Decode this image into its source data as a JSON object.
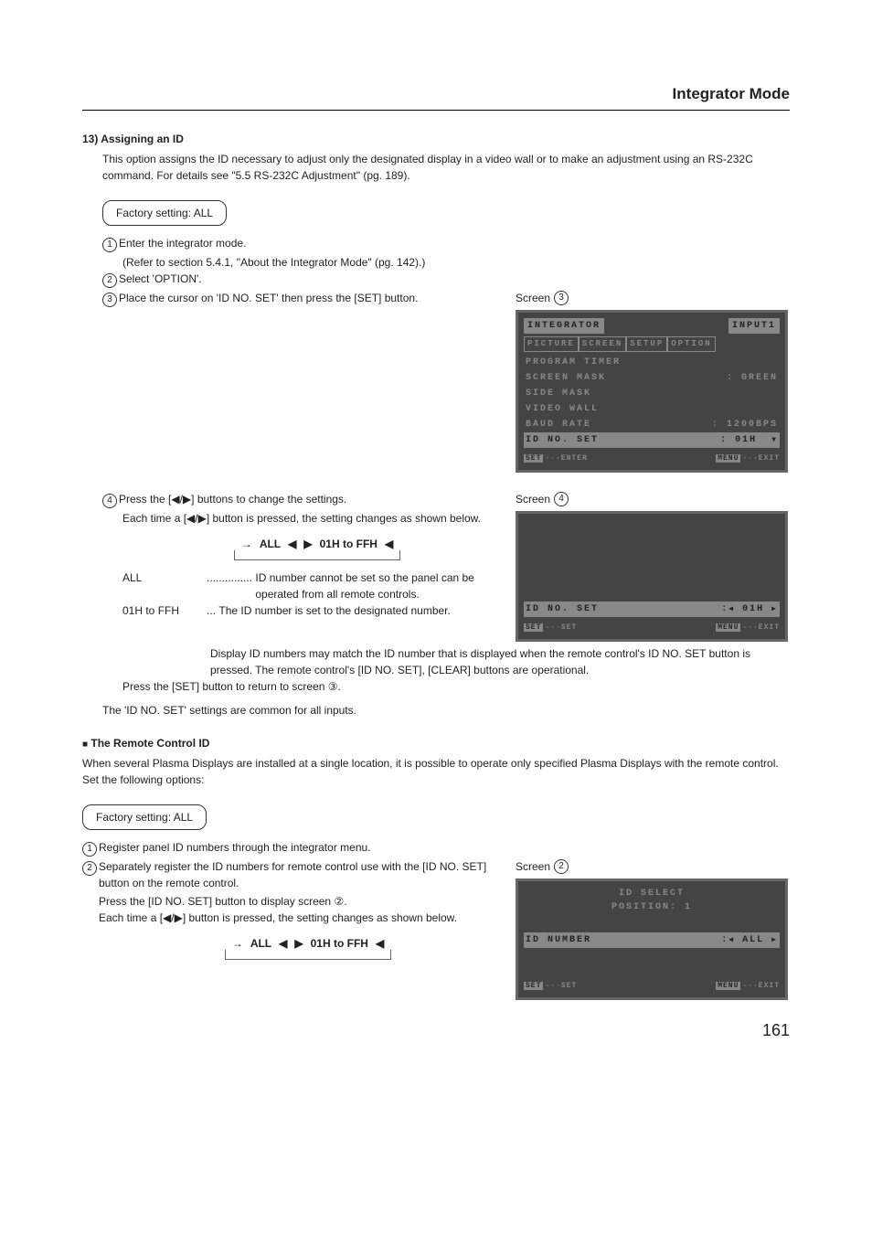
{
  "page_title": "Integrator Mode",
  "h13": "13) Assigning an ID",
  "intro": "This option assigns the ID necessary to adjust only the designated display in a video wall or to make an adjustment using an RS-232C command. For details see \"5.5 RS-232C Adjustment\" (pg. 189).",
  "factory_a": "Factory setting: ALL",
  "step1": "Enter the integrator mode.",
  "step1_sub": "(Refer to section 5.4.1, \"About the Integrator Mode\" (pg. 142).)",
  "step2": "Select 'OPTION'.",
  "step3": "Place the cursor on 'ID NO. SET' then press the [SET] button.",
  "screen3_label": "Screen",
  "osd3": {
    "title": "INTEGRATOR",
    "input": "INPUT1",
    "tabs": [
      "PICTURE",
      "SCREEN",
      "SETUP",
      "OPTION"
    ],
    "items": [
      {
        "k": "PROGRAM TIMER",
        "v": ""
      },
      {
        "k": "SCREEN MASK",
        "v": ": GREEN"
      },
      {
        "k": "SIDE MASK",
        "v": ""
      },
      {
        "k": "VIDEO WALL",
        "v": ""
      },
      {
        "k": "BAUD RATE",
        "v": ": 1200BPS"
      },
      {
        "k": "ID NO. SET",
        "v": ": 01H"
      }
    ],
    "hint_l": "SET",
    "hint_l2": "···ENTER",
    "hint_r": "MENU",
    "hint_r2": "···EXIT"
  },
  "step4": "Press the [◀/▶] buttons to change the settings.",
  "step4_sub": "Each time a [◀/▶] button is pressed, the setting changes as shown below.",
  "screen4_label": "Screen",
  "cycle": {
    "a": "ALL",
    "b": "01H to FFH"
  },
  "def_all_k": "ALL",
  "def_all_dots": "...............",
  "def_all_v": "ID number cannot be set so the panel can be operated from all remote controls.",
  "def_ffh_k": "01H to FFH",
  "def_ffh_dots": "...",
  "def_ffh_v": "The ID number is set to the designated number.",
  "osd4": {
    "k": "ID NO. SET",
    "v": "01H",
    "hint_l": "SET",
    "hint_l2": "···SET",
    "hint_r": "MENU",
    "hint_r2": "···EXIT"
  },
  "note_idmatch": "Display ID numbers may match the ID number that is displayed when the remote control's ID NO. SET button is pressed. The remote control's [ID NO. SET], [CLEAR] buttons are operational.",
  "note_return": "Press the [SET] button to return to screen ③.",
  "note_common": "The 'ID NO. SET' settings are common for all inputs.",
  "remote_heading": "The Remote Control ID",
  "remote_intro": "When several Plasma Displays are installed at a single location, it is possible to operate only specified Plasma Displays with the remote control. Set the following options:",
  "factory_b": "Factory setting: ALL",
  "r_step1": "Register panel ID numbers through the integrator menu.",
  "r_step2": "Separately register the ID numbers for remote control use with the [ID NO. SET] button on the remote control.",
  "r_step2_a": "Press the [ID NO. SET] button to display screen ②.",
  "r_step2_b": "Each time a [◀/▶] button is pressed, the setting changes as shown below.",
  "screen2_label": "Screen",
  "osd2": {
    "t1": "ID SELECT",
    "t2": "POSITION: 1",
    "k": "ID NUMBER",
    "v": "ALL",
    "hint_l": "SET",
    "hint_l2": "···SET",
    "hint_r": "MENU",
    "hint_r2": "···EXIT"
  },
  "page_num": "161"
}
